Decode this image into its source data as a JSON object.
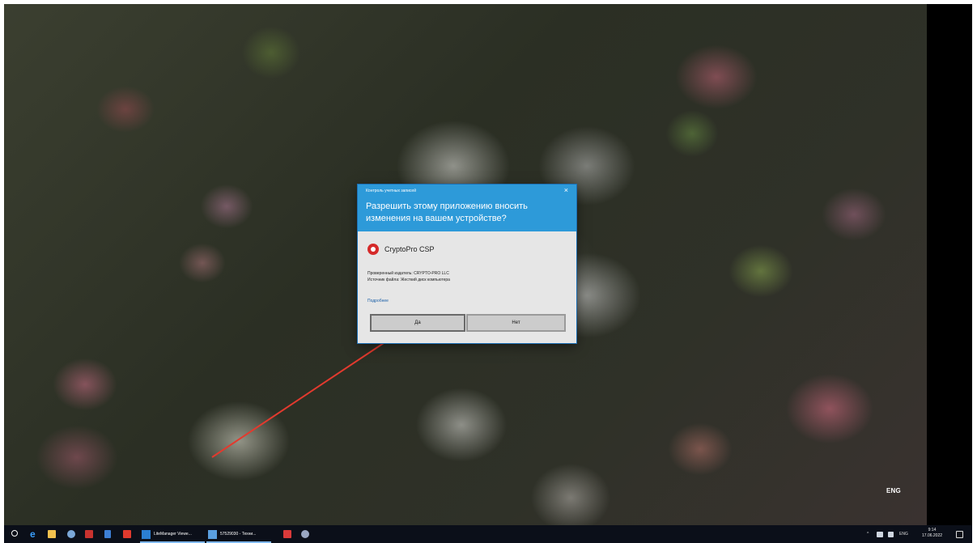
{
  "dialog": {
    "title": "Контроль учетных записей",
    "question": "Разрешить этому приложению вносить изменения на вашем устройстве?",
    "app_name": "CryptoPro CSP",
    "publisher": "Проверенный издатель: CRYPTO-PRO LLC",
    "source": "Источник файла: Жесткий диск компьютера",
    "details_link": "Подробнее",
    "yes_label": "Да",
    "no_label": "Нет",
    "close_glyph": "×"
  },
  "desktop": {
    "language_label": "ENG"
  },
  "taskbar": {
    "apps": [
      {
        "label": "LiteManager Viewe...",
        "icon": "litemanager-icon"
      },
      {
        "label": "57529030 - Техни...",
        "icon": "window-icon"
      }
    ],
    "tray": {
      "language": "ENG",
      "time": "9:14",
      "date": "17.06.2022"
    }
  },
  "colors": {
    "dialog_header": "#2d9ad9",
    "arrow": "#e23a2e",
    "taskbar": "#0b0f19"
  }
}
